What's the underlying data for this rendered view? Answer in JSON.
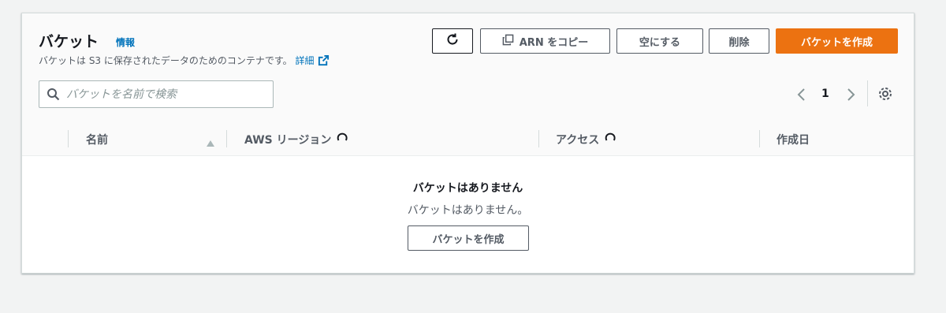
{
  "header": {
    "title": "バケット",
    "info_link": "情報",
    "description": "バケットは S3 に保存されたデータのためのコンテナです。",
    "learn_more_link": "詳細"
  },
  "toolbar": {
    "refresh_icon": "refresh-icon",
    "copy_arn_label": "ARN をコピー",
    "empty_label": "空にする",
    "delete_label": "削除",
    "create_bucket_label": "バケットを作成"
  },
  "search": {
    "placeholder": "バケットを名前で検索",
    "value": ""
  },
  "pagination": {
    "current_page": "1"
  },
  "table": {
    "columns": [
      {
        "label": "名前",
        "sort": "ascending"
      },
      {
        "label": "AWS リージョン",
        "loading": true
      },
      {
        "label": "アクセス",
        "loading": true
      },
      {
        "label": "作成日"
      }
    ],
    "rows": []
  },
  "empty_state": {
    "title": "バケットはありません",
    "description": "バケットはありません。",
    "create_button_label": "バケットを作成"
  },
  "colors": {
    "primary_button": "#ec7211",
    "link": "#0073bb",
    "text": "#16191f",
    "secondary_text": "#545b64"
  }
}
